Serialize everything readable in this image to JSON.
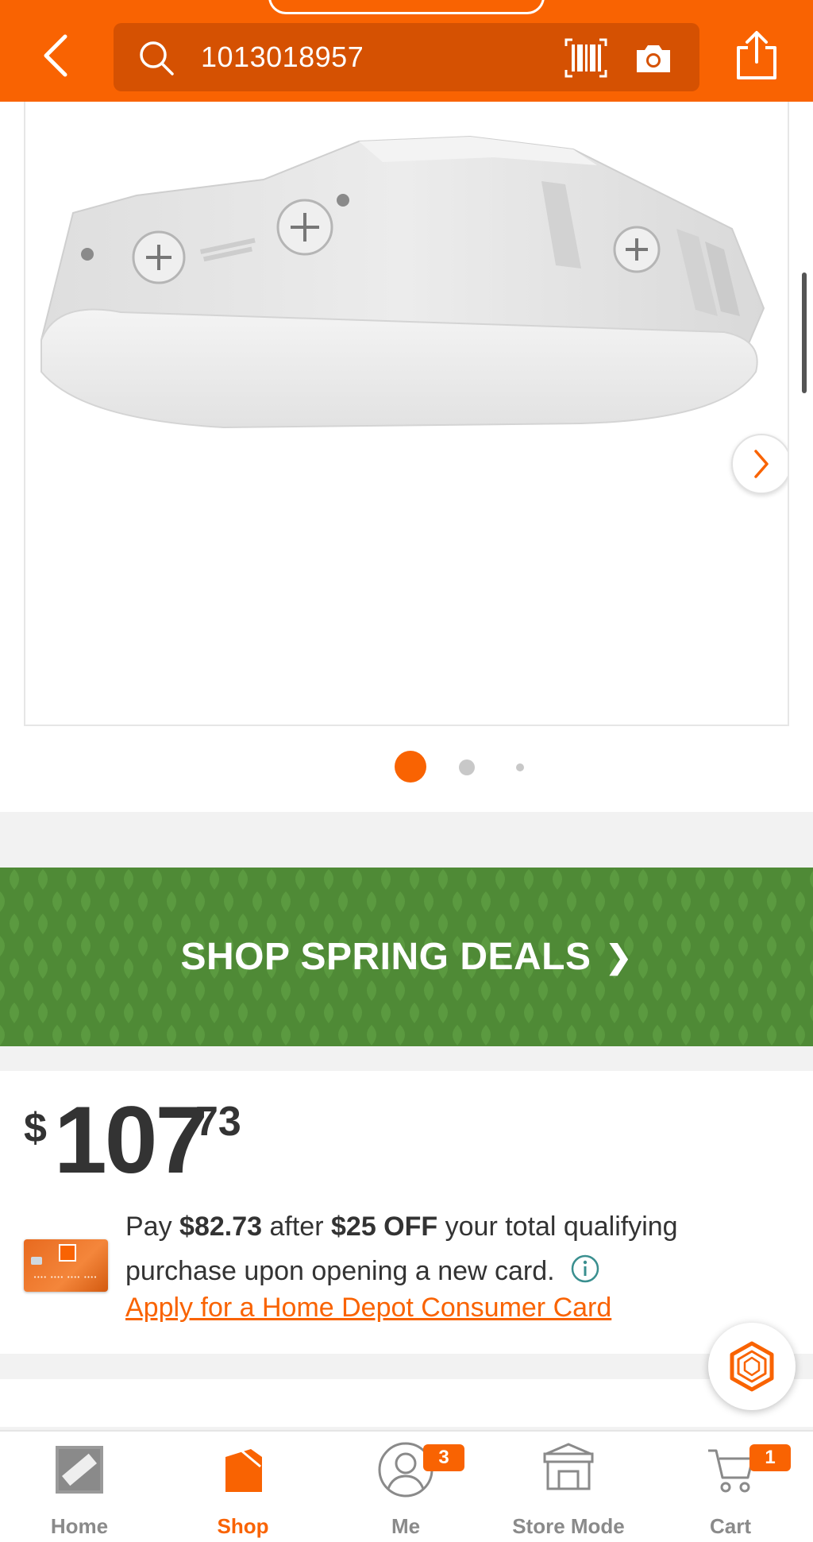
{
  "header": {
    "search_value": "1013018957",
    "accent": "#f96302",
    "icons": [
      "back-icon",
      "search-icon",
      "barcode-icon",
      "camera-icon",
      "share-icon"
    ]
  },
  "gallery": {
    "image_count": 3,
    "active_index": 0
  },
  "banner": {
    "text": "SHOP SPRING DEALS",
    "chevron": "❯",
    "color": "#4f8a36"
  },
  "price": {
    "currency": "$",
    "dollars": "107",
    "cents": "73"
  },
  "promo": {
    "pay_prefix": "Pay",
    "pay_amount": "$82.73",
    "after_text": "after",
    "discount": "$25 OFF",
    "rest_text": "your total qualifying purchase upon opening a new card.",
    "apply_link": "Apply for a Home Depot Consumer Card"
  },
  "bottom_nav": {
    "items": [
      {
        "label": "Home",
        "icon": "home-depot-logo-icon",
        "active": false
      },
      {
        "label": "Shop",
        "icon": "shop-icon",
        "active": true
      },
      {
        "label": "Me",
        "icon": "user-icon",
        "active": false,
        "badge": "3"
      },
      {
        "label": "Store Mode",
        "icon": "store-icon",
        "active": false
      },
      {
        "label": "Cart",
        "icon": "cart-icon",
        "active": false,
        "badge": "1"
      }
    ]
  }
}
